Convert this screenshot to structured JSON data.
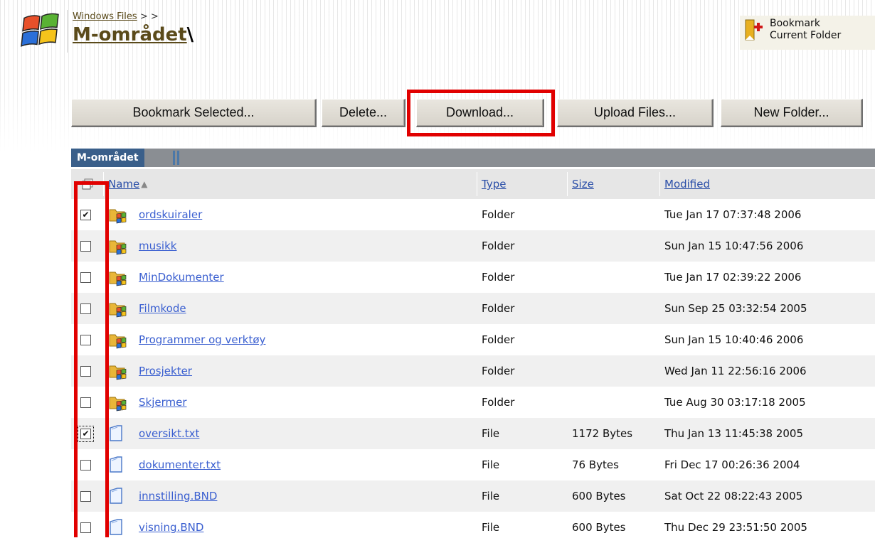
{
  "header": {
    "breadcrumb": {
      "link": "Windows Files",
      "separator": "> >"
    },
    "folder_title": "M-området",
    "folder_suffix": "\\",
    "bookmark_current": {
      "line1": "Bookmark",
      "line2": "Current Folder",
      "icon": "bookmark-add-icon"
    }
  },
  "toolbar": {
    "bookmark_selected": "Bookmark Selected...",
    "delete": "Delete...",
    "download": "Download...",
    "upload": "Upload Files...",
    "new_folder": "New Folder..."
  },
  "tab": {
    "label": "M-området"
  },
  "table": {
    "columns": {
      "name": "Name",
      "type": "Type",
      "size": "Size",
      "modified": "Modified"
    },
    "sort_indicator": "▲",
    "rows": [
      {
        "checked": true,
        "kind": "folder",
        "name": "ordskuiraler",
        "type": "Folder",
        "size": "",
        "modified": "Tue Jan 17 07:37:48 2006"
      },
      {
        "checked": false,
        "kind": "folder",
        "name": "musikk",
        "type": "Folder",
        "size": "",
        "modified": "Sun Jan 15 10:47:56 2006"
      },
      {
        "checked": false,
        "kind": "folder",
        "name": "MinDokumenter",
        "type": "Folder",
        "size": "",
        "modified": "Tue Jan 17 02:39:22 2006"
      },
      {
        "checked": false,
        "kind": "folder",
        "name": "Filmkode",
        "type": "Folder",
        "size": "",
        "modified": "Sun Sep 25 03:32:54 2005"
      },
      {
        "checked": false,
        "kind": "folder",
        "name": "Programmer og verktøy",
        "type": "Folder",
        "size": "",
        "modified": "Sun Jan 15 10:40:46 2006"
      },
      {
        "checked": false,
        "kind": "folder",
        "name": "Prosjekter",
        "type": "Folder",
        "size": "",
        "modified": "Wed Jan 11 22:56:16 2006"
      },
      {
        "checked": false,
        "kind": "folder",
        "name": "Skjermer",
        "type": "Folder",
        "size": "",
        "modified": "Tue Aug 30 03:17:18 2005"
      },
      {
        "checked": true,
        "kind": "file",
        "name": "oversikt.txt",
        "type": "File",
        "size": "1172 Bytes",
        "modified": "Thu Jan 13 11:45:38 2005"
      },
      {
        "checked": false,
        "kind": "file",
        "name": "dokumenter.txt",
        "type": "File",
        "size": "76 Bytes",
        "modified": "Fri Dec 17 00:26:36 2004"
      },
      {
        "checked": false,
        "kind": "file",
        "name": "innstilling.BND",
        "type": "File",
        "size": "600 Bytes",
        "modified": "Sat Oct 22 08:22:43 2005"
      },
      {
        "checked": false,
        "kind": "file",
        "name": "visning.BND",
        "type": "File",
        "size": "600 Bytes",
        "modified": "Thu Dec 29 23:51:50 2005"
      }
    ]
  },
  "colors": {
    "highlight": "#e10000",
    "tab": "#3a5f8a",
    "link": "#3a5fd0"
  }
}
